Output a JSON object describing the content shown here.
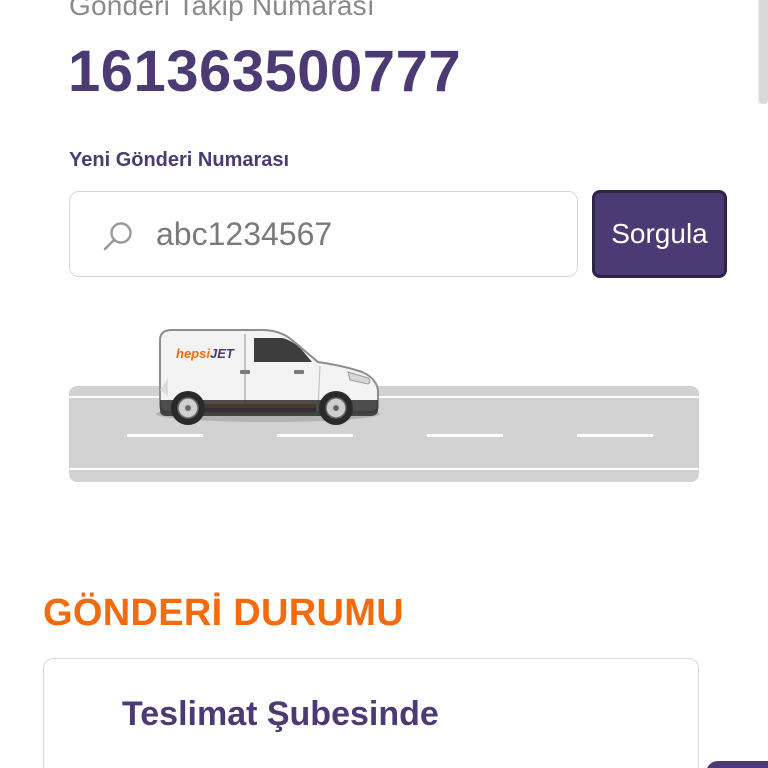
{
  "tracking": {
    "label": "Gönderi Takip Numarası",
    "number": "161363500777"
  },
  "search": {
    "label": "Yeni Gönderi Numarası",
    "value": "abc1234567",
    "button_label": "Sorgula"
  },
  "illustration": {
    "van_brand_prefix": "hepsi",
    "van_brand_suffix": "JET",
    "colors": {
      "brand_orange": "#f26b0f",
      "brand_purple": "#4b3a73"
    }
  },
  "status": {
    "section_title": "GÖNDERİ DURUMU",
    "current": "Teslimat Şubesinde"
  },
  "colors": {
    "primary": "#4b3a73",
    "accent": "#f26b0f",
    "muted_text": "#8a8a8a"
  }
}
